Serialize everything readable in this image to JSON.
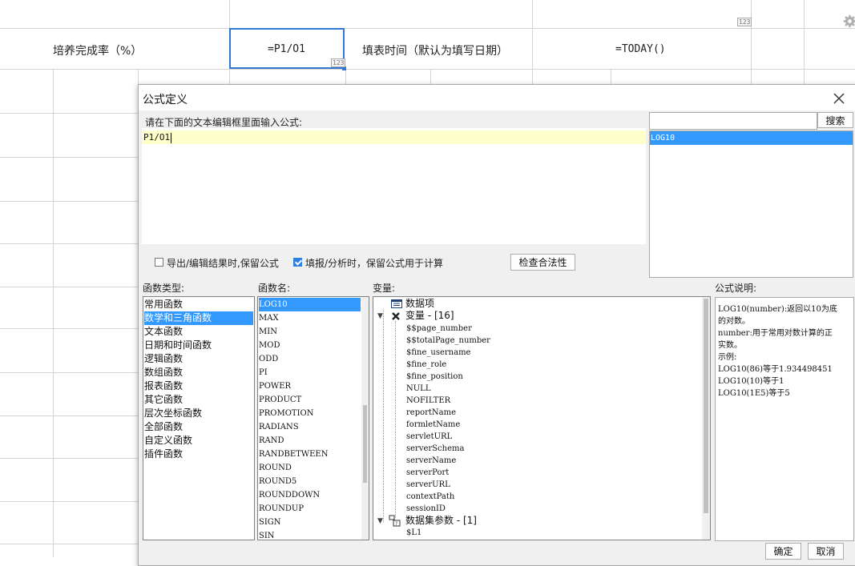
{
  "sheet": {
    "cell_label_rate": "培养完成率（%）",
    "cell_formula_rate": "=P1/O1",
    "cell_label_time": "填表时间（默认为填写日期）",
    "cell_formula_time": "=TODAY()",
    "badge": "123"
  },
  "dialog": {
    "title": "公式定义",
    "editor_hint": "请在下面的文本编辑框里面输入公式:",
    "formula_text": "P1/O1",
    "search_value": "",
    "search_button": "搜索",
    "search_results": [
      "LOG10"
    ],
    "options": {
      "export_keep_label": "导出/编辑结果时,保留公式",
      "export_keep_checked": false,
      "fill_keep_label": "填报/分析时，保留公式用于计算",
      "fill_keep_checked": true
    },
    "check_button": "检查合法性",
    "function_type_label": "函数类型:",
    "function_types": [
      "常用函数",
      "数学和三角函数",
      "文本函数",
      "日期和时间函数",
      "逻辑函数",
      "数组函数",
      "报表函数",
      "其它函数",
      "层次坐标函数",
      "全部函数",
      "自定义函数",
      "插件函数"
    ],
    "function_type_selected": 1,
    "function_name_label": "函数名:",
    "function_names": [
      "LOG10",
      "MAX",
      "MIN",
      "MOD",
      "ODD",
      "PI",
      "POWER",
      "PRODUCT",
      "PROMOTION",
      "RADIANS",
      "RAND",
      "RANDBETWEEN",
      "ROUND",
      "ROUND5",
      "ROUNDDOWN",
      "ROUNDUP",
      "SIGN",
      "SIN"
    ],
    "function_name_selected": 0,
    "variable_label": "变量:",
    "variables": {
      "data_item": "数据项",
      "var_group": "变量 - [16]",
      "var_items": [
        "$$page_number",
        "$$totalPage_number",
        "$fine_username",
        "$fine_role",
        "$fine_position",
        "NULL",
        "NOFILTER",
        "reportName",
        "formletName",
        "servletURL",
        "serverSchema",
        "serverName",
        "serverPort",
        "serverURL",
        "contextPath",
        "sessionID"
      ],
      "dataset_group": "数据集参数 - [1]",
      "dataset_items": [
        "$L1"
      ]
    },
    "desc_label": "公式说明:",
    "desc_lines": [
      "LOG10(number):返回以10为底",
      "的对数。",
      "number:用于常用对数计算的正",
      "实数。",
      "示例:",
      "LOG10(86)等于1.934498451",
      "LOG10(10)等于1",
      "LOG10(1E5)等于5"
    ],
    "ok_button": "确定",
    "cancel_button": "取消"
  }
}
